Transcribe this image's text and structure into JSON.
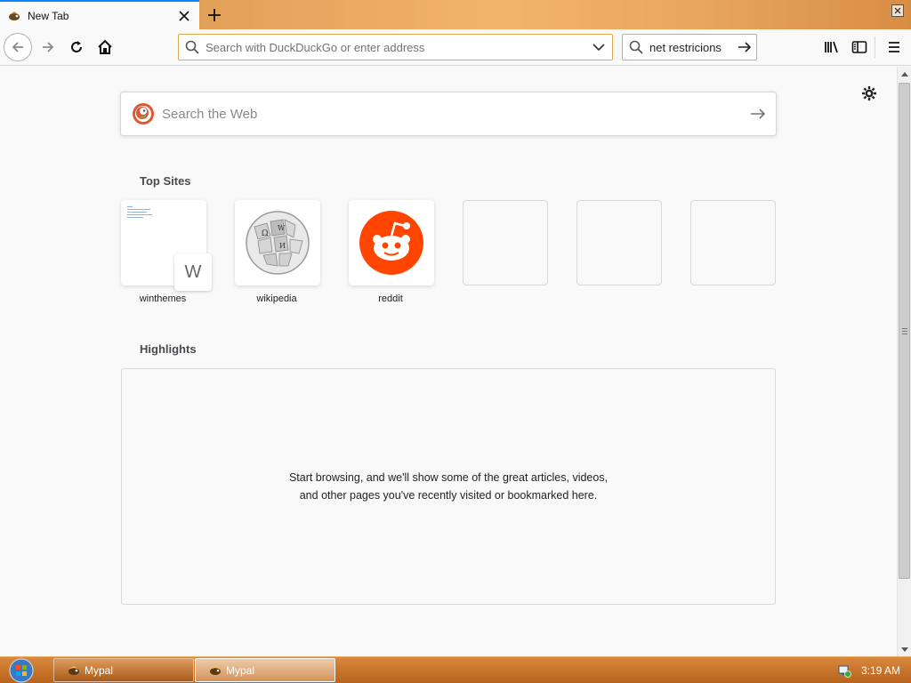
{
  "tab": {
    "title": "New Tab",
    "close_icon": "close-icon",
    "new_tab_icon": "plus-icon"
  },
  "navbar": {
    "urlbar_placeholder": "Search with DuckDuckGo or enter address",
    "searchbar_text": "net restricions",
    "urlbar_border_color": "#e0a64b"
  },
  "newtab": {
    "search_placeholder": "Search the Web",
    "top_sites_title": "Top Sites",
    "top_sites": [
      {
        "label": "winthemes",
        "badge": "W"
      },
      {
        "label": "wikipedia"
      },
      {
        "label": "reddit"
      }
    ],
    "highlights_title": "Highlights",
    "highlights_message": "Start browsing, and we'll show some of the great articles, videos, and other pages you've recently visited or bookmarked here."
  },
  "taskbar": {
    "tasks": [
      {
        "label": "Mypal"
      },
      {
        "label": "Mypal"
      }
    ],
    "clock": "3:19 AM"
  },
  "colors": {
    "accent": "#0a84ff",
    "reddit": "#ff4500",
    "taskbar": "#c9752c"
  }
}
